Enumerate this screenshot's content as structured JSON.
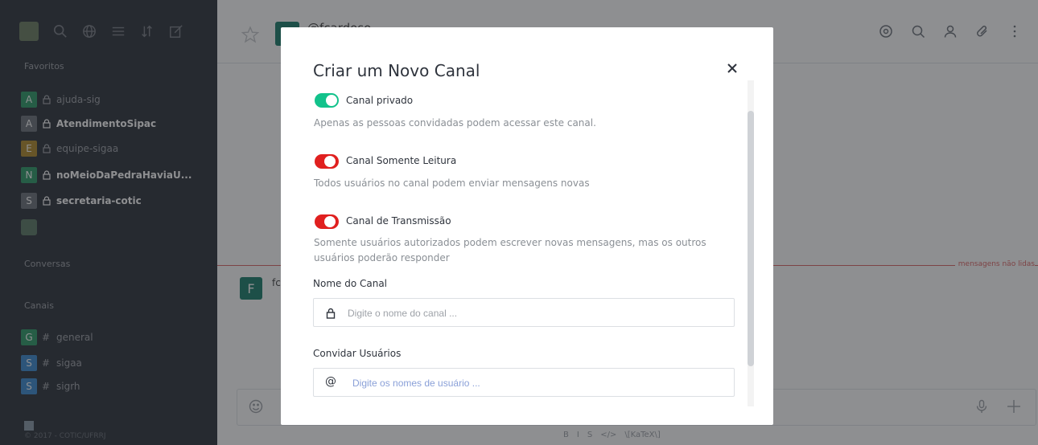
{
  "sidebar": {
    "favorites_title": "Favoritos",
    "conversations_title": "Conversas",
    "channels_title": "Canais",
    "favorites": [
      {
        "initial": "A",
        "name": "ajuda-sig",
        "color": "#2e9a69",
        "bold": false
      },
      {
        "initial": "A",
        "name": "AtendimentoSipac",
        "color": "#6c727a",
        "bold": true
      },
      {
        "initial": "E",
        "name": "equipe-sigaa",
        "color": "#b08a2c",
        "bold": false
      },
      {
        "initial": "N",
        "name": "noMeioDaPedraHaviaU...",
        "color": "#2e9a69",
        "bold": true
      },
      {
        "initial": "S",
        "name": "secretaria-cotic",
        "color": "#6c727a",
        "bold": true
      }
    ],
    "channels": [
      {
        "initial": "G",
        "name": "general",
        "color": "#2e9a69"
      },
      {
        "initial": "S",
        "name": "sigaa",
        "color": "#3d8ad1"
      },
      {
        "initial": "S",
        "name": "sigrh",
        "color": "#3d8ad1"
      }
    ],
    "footer": "© 2017 - COTIC/UFRRJ"
  },
  "main": {
    "room_name": "@fcardoso",
    "unread_label": "mensagens não lidas",
    "message_author_initial": "F",
    "message_author": "fc",
    "formatting": [
      "B",
      "I",
      "S",
      "</>",
      "\\[KaTeX\\]"
    ]
  },
  "modal": {
    "title": "Criar um Novo Canal",
    "toggles": [
      {
        "label": "Canal privado",
        "description": "Apenas as pessoas convidadas podem acessar este canal.",
        "on": true
      },
      {
        "label": "Canal Somente Leitura",
        "description": "Todos usuários no canal podem enviar mensagens novas",
        "on": false
      },
      {
        "label": "Canal de Transmissão",
        "description": "Somente usuários autorizados podem escrever novas mensagens, mas os outros usuários poderão responder",
        "on": false
      }
    ],
    "channel_name_label": "Nome do Canal",
    "channel_name_placeholder": "Digite o nome do canal ...",
    "invite_label": "Convidar Usuários",
    "invite_placeholder": "Digite os nomes de usuário ..."
  },
  "colors": {
    "sidebar_bg": "#2f343d",
    "toggle_on": "#12c28b",
    "toggle_off": "#e0201f",
    "unread": "#dd6666"
  }
}
